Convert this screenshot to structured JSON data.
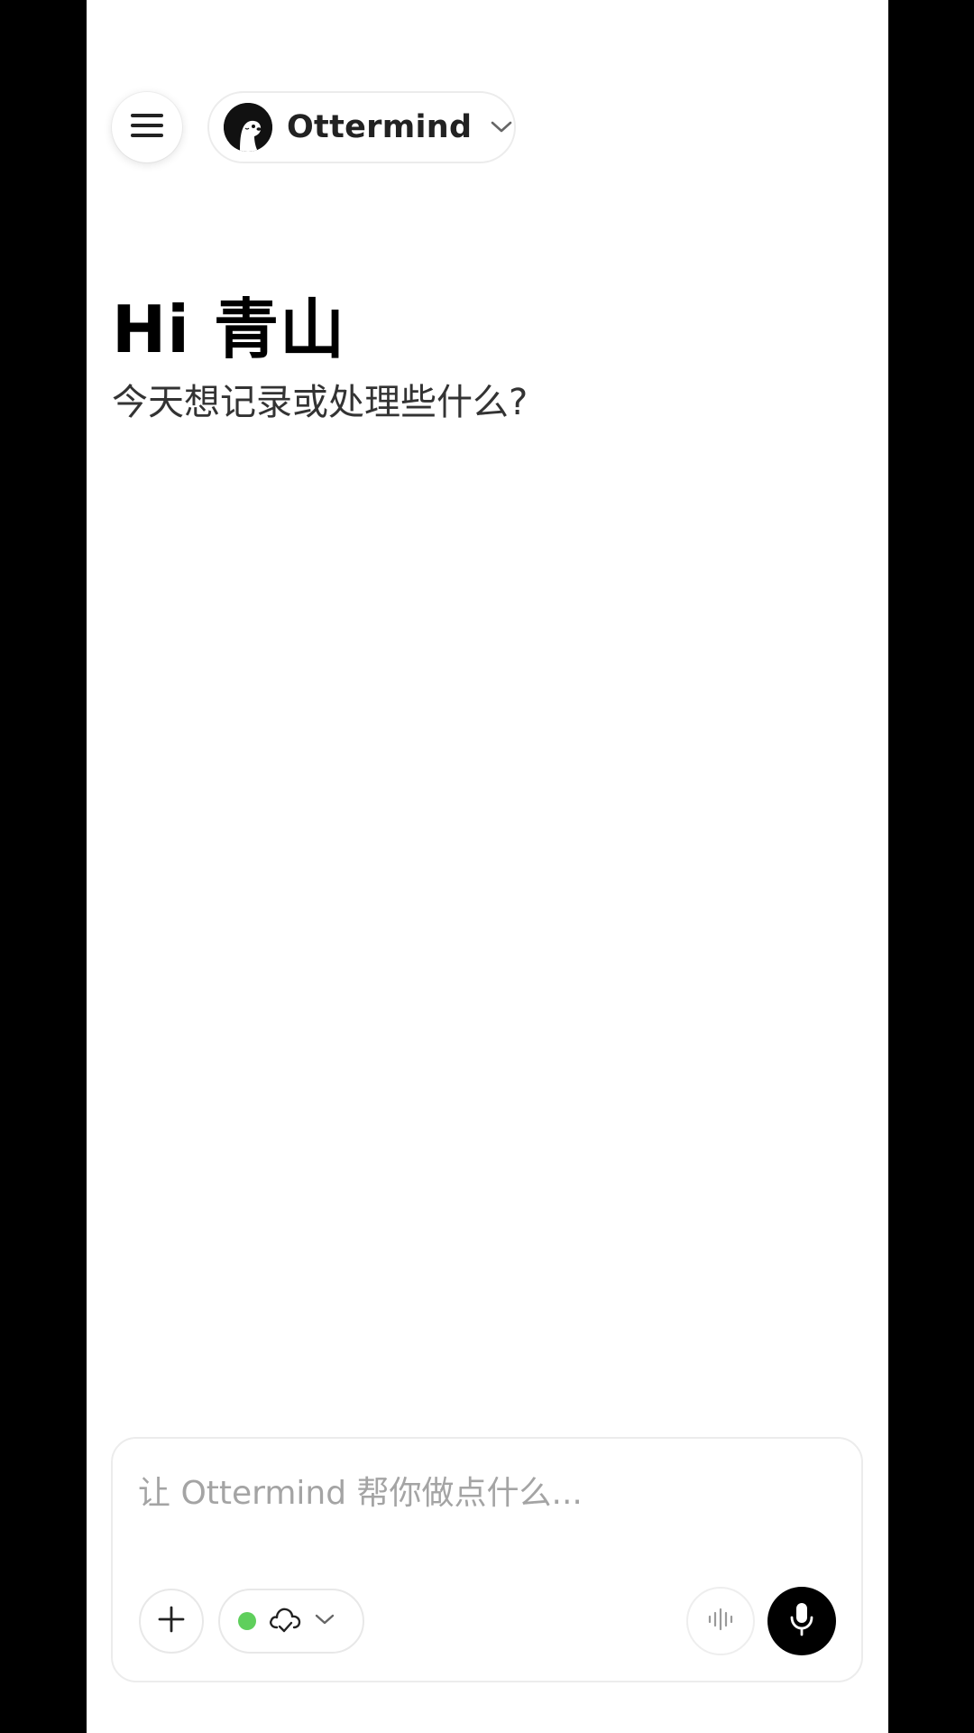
{
  "header": {
    "menu_icon": "hamburger-menu-icon",
    "model_avatar_icon": "otter-icon",
    "model_name": "Ottermind",
    "model_chevron_icon": "chevron-down-icon"
  },
  "greeting": {
    "title": "Hi 青山",
    "subtitle": "今天想记录或处理些什么?"
  },
  "composer": {
    "placeholder": "让 Ottermind 帮你做点什么...",
    "value": "",
    "add_icon": "plus-icon",
    "mode_status_color": "#5fcf5c",
    "mode_icon": "cloud-check-icon",
    "mode_chevron_icon": "chevron-down-icon",
    "voice_wave_icon": "sound-wave-icon",
    "mic_icon": "microphone-icon"
  },
  "colors": {
    "background": "#ffffff",
    "letterbox": "#000000",
    "accent": "#000000",
    "status_green": "#5fcf5c",
    "placeholder": "#a4a4a4"
  }
}
